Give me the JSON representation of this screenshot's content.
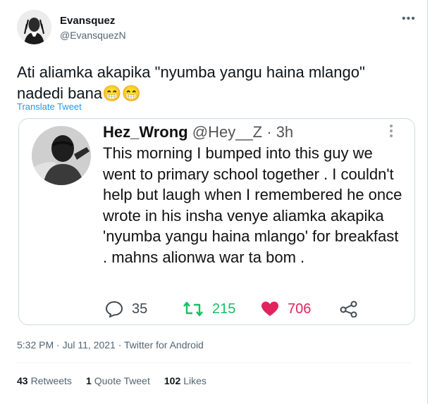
{
  "author": {
    "display_name": "Evansquez",
    "handle": "@EvansquezN"
  },
  "more_icon": "more-horizontal-icon",
  "tweet": {
    "text": "Ati aliamka akapika \"nyumba yangu haina mlango\" nadedi bana😁😁",
    "translate_label": "Translate Tweet"
  },
  "quoted": {
    "name": "Hez_Wrong",
    "handle": "@Hey__Z",
    "separator": "·",
    "age": "3h",
    "text": "This morning I bumped into this guy we went to primary school together . I couldn't help but laugh when I remembered he once wrote in his insha venye aliamka akapika 'nyumba yangu haina mlango' for breakfast . mahns alionwa war ta bom .",
    "actions": {
      "replies": "35",
      "retweets": "215",
      "likes": "706"
    },
    "colors": {
      "retweet": "#17bf63",
      "like": "#e0245e"
    }
  },
  "timestamp": "5:32 PM · Jul 11, 2021 · Twitter for Android",
  "stats": {
    "retweets_count": "43",
    "retweets_label": "Retweets",
    "quotes_count": "1",
    "quotes_label": "Quote Tweet",
    "likes_count": "102",
    "likes_label": "Likes"
  }
}
